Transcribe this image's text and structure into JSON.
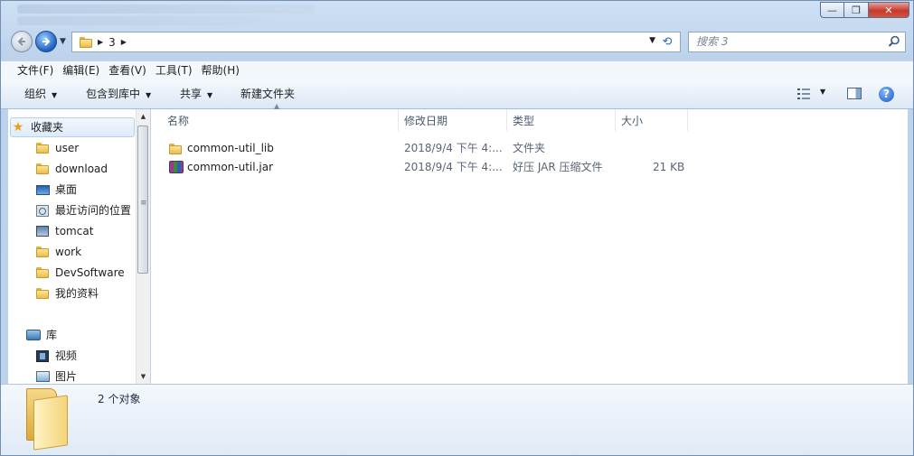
{
  "window": {
    "controls": {
      "minimize": "—",
      "maximize": "❐",
      "close": "✕"
    }
  },
  "navigation": {
    "breadcrumb": [
      "3"
    ],
    "search_placeholder": "搜索 3"
  },
  "menubar": {
    "items": [
      "文件(F)",
      "编辑(E)",
      "查看(V)",
      "工具(T)",
      "帮助(H)"
    ]
  },
  "toolbar": {
    "organize": "组织",
    "include_in_library": "包含到库中",
    "share": "共享",
    "new_folder": "新建文件夹"
  },
  "sidebar": {
    "favorites_label": "收藏夹",
    "favorites": [
      "user",
      "download",
      "桌面",
      "最近访问的位置",
      "tomcat",
      "work",
      "DevSoftware",
      "我的资料"
    ],
    "libraries_label": "库",
    "libraries": [
      "视频",
      "图片"
    ]
  },
  "columns": {
    "name": "名称",
    "date": "修改日期",
    "type": "类型",
    "size": "大小"
  },
  "files": [
    {
      "name": "common-util_lib",
      "date": "2018/9/4 下午 4:...",
      "type": "文件夹",
      "size": "",
      "icon": "folder-icon"
    },
    {
      "name": "common-util.jar",
      "date": "2018/9/4 下午 4:...",
      "type": "好压 JAR 压缩文件",
      "size": "21 KB",
      "icon": "archive-icon"
    }
  ],
  "details": {
    "count": "2 个对象"
  },
  "colors": {
    "frame": "#bcd2eb",
    "content_bg": "#ffffff",
    "accent": "#1d5fbf",
    "close_button": "#c7392d"
  }
}
